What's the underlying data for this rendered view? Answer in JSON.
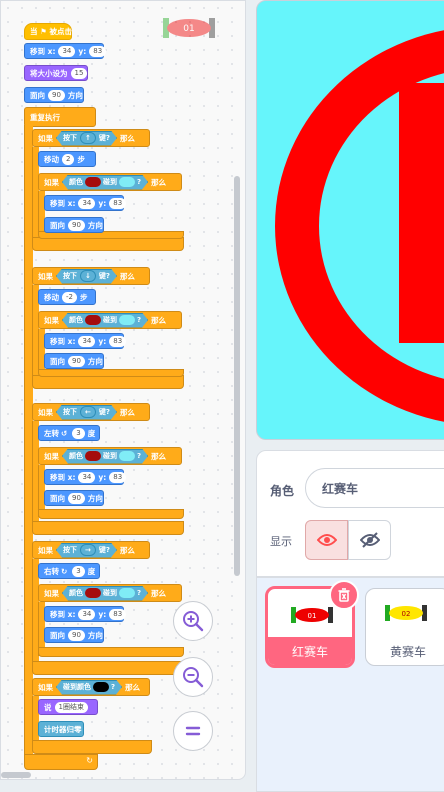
{
  "code": {
    "hat_label": "当 ⚑ 被点击",
    "goto_label": "移到 x:",
    "y_label": "y:",
    "x_val": "34",
    "y_val": "83",
    "size_label": "将大小设为",
    "size_val": "15",
    "dir_label": "面向",
    "dir_val": "90",
    "dir_suffix": "方向",
    "forever_label": "重复执行",
    "if_label": "如果",
    "then_label": "那么",
    "key_pressed_prefix": "按下",
    "key_pressed_suffix": "键?",
    "keys": [
      "↑",
      "↓",
      "←",
      "→"
    ],
    "move_label": "移动",
    "steps_label": "步",
    "move_up": "2",
    "move_down": "-2",
    "color_label": "颜色",
    "touch_label": "碰到",
    "q_mark": "?",
    "turn_left_label": "左转",
    "turn_right_label": "右转",
    "turn_val": "3",
    "degree_label": "度",
    "touch_color_label": "碰到颜色",
    "say_label": "说",
    "say_val": "1圈结束",
    "timer_reset_label": "计时器归零"
  },
  "colors": {
    "dark_red": "#a50d0d",
    "light_cyan": "#80ecf6",
    "black": "#000000"
  },
  "sprite_info": {
    "sprite_label": "角色",
    "sprite_name": "红赛车",
    "show_label": "显示"
  },
  "sprites": [
    {
      "name": "红赛车",
      "selected": true,
      "number": "01"
    },
    {
      "name": "黄赛车",
      "selected": false,
      "number": "02"
    }
  ],
  "icons": {
    "zoom_in": "zoom-in-icon",
    "zoom_out": "zoom-out-icon",
    "reset_zoom": "reset-zoom-icon",
    "show": "eye-icon",
    "hide": "eye-slash-icon",
    "delete": "trash-icon"
  }
}
